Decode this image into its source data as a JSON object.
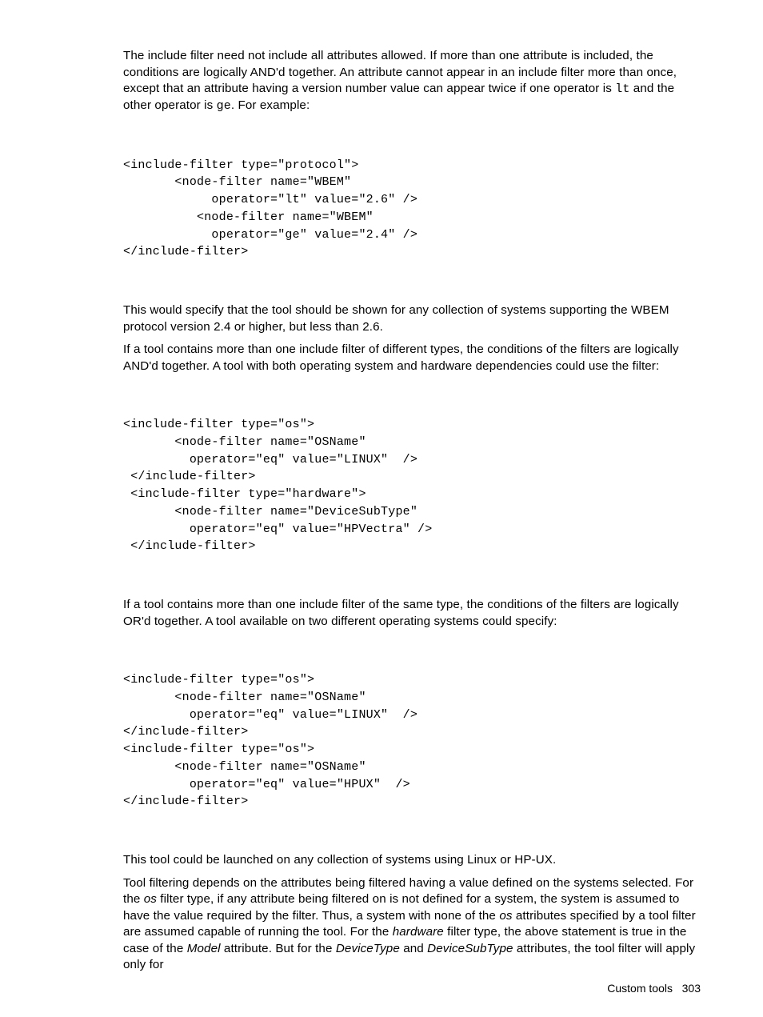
{
  "para1_pre": "The include filter need not include all attributes allowed. If more than one attribute is included, the conditions are logically AND'd together. An attribute cannot appear in an include filter more than once, except that an attribute having a version number value can appear twice if one operator is ",
  "para1_code1": "lt",
  "para1_mid": " and the other operator is ",
  "para1_code2": "ge",
  "para1_post": ". For example:",
  "code1": "<include-filter type=\"protocol\">\n       <node-filter name=\"WBEM\"\n            operator=\"lt\" value=\"2.6\" />\n          <node-filter name=\"WBEM\"\n            operator=\"ge\" value=\"2.4\" />\n</include-filter>",
  "para2": "This would specify that the tool should be shown for any collection of systems supporting the WBEM protocol version 2.4 or higher, but less than 2.6.",
  "para3": "If a tool contains more than one include filter of different types, the conditions of the filters are logically AND'd together. A tool with both operating system and hardware dependencies could use the filter:",
  "code2": "<include-filter type=\"os\">\n       <node-filter name=\"OSName\"\n         operator=\"eq\" value=\"LINUX\"  />\n </include-filter>\n <include-filter type=\"hardware\">\n       <node-filter name=\"DeviceSubType\"\n         operator=\"eq\" value=\"HPVectra\" />\n </include-filter>",
  "para4": "If a tool contains more than one include filter of the same type, the conditions of the filters are logically OR'd together. A tool available on two different operating systems could specify:",
  "code3": "<include-filter type=\"os\">\n       <node-filter name=\"OSName\"\n         operator=\"eq\" value=\"LINUX\"  />\n</include-filter>\n<include-filter type=\"os\">\n       <node-filter name=\"OSName\"\n         operator=\"eq\" value=\"HPUX\"  />\n</include-filter>",
  "para5": "This tool could be launched on any collection of systems using Linux or HP-UX.",
  "para6_a": "Tool filtering depends on the attributes being filtered having a value defined on the systems selected. For the ",
  "para6_i1": "os",
  "para6_b": " filter type, if any attribute being filtered on is not defined for a system, the system is assumed to have the value required by the filter. Thus, a system with none of the ",
  "para6_i2": "os",
  "para6_c": " attributes specified by a tool filter are assumed capable of running the tool. For the ",
  "para6_i3": "hardware",
  "para6_d": " filter type, the above statement is true in the case of the ",
  "para6_i4": "Model",
  "para6_e": " attribute. But for the ",
  "para6_i5": "DeviceType",
  "para6_f": " and ",
  "para6_i6": "DeviceSubType",
  "para6_g": " attributes, the tool filter will apply only for",
  "footer_label": "Custom tools",
  "footer_page": "303"
}
